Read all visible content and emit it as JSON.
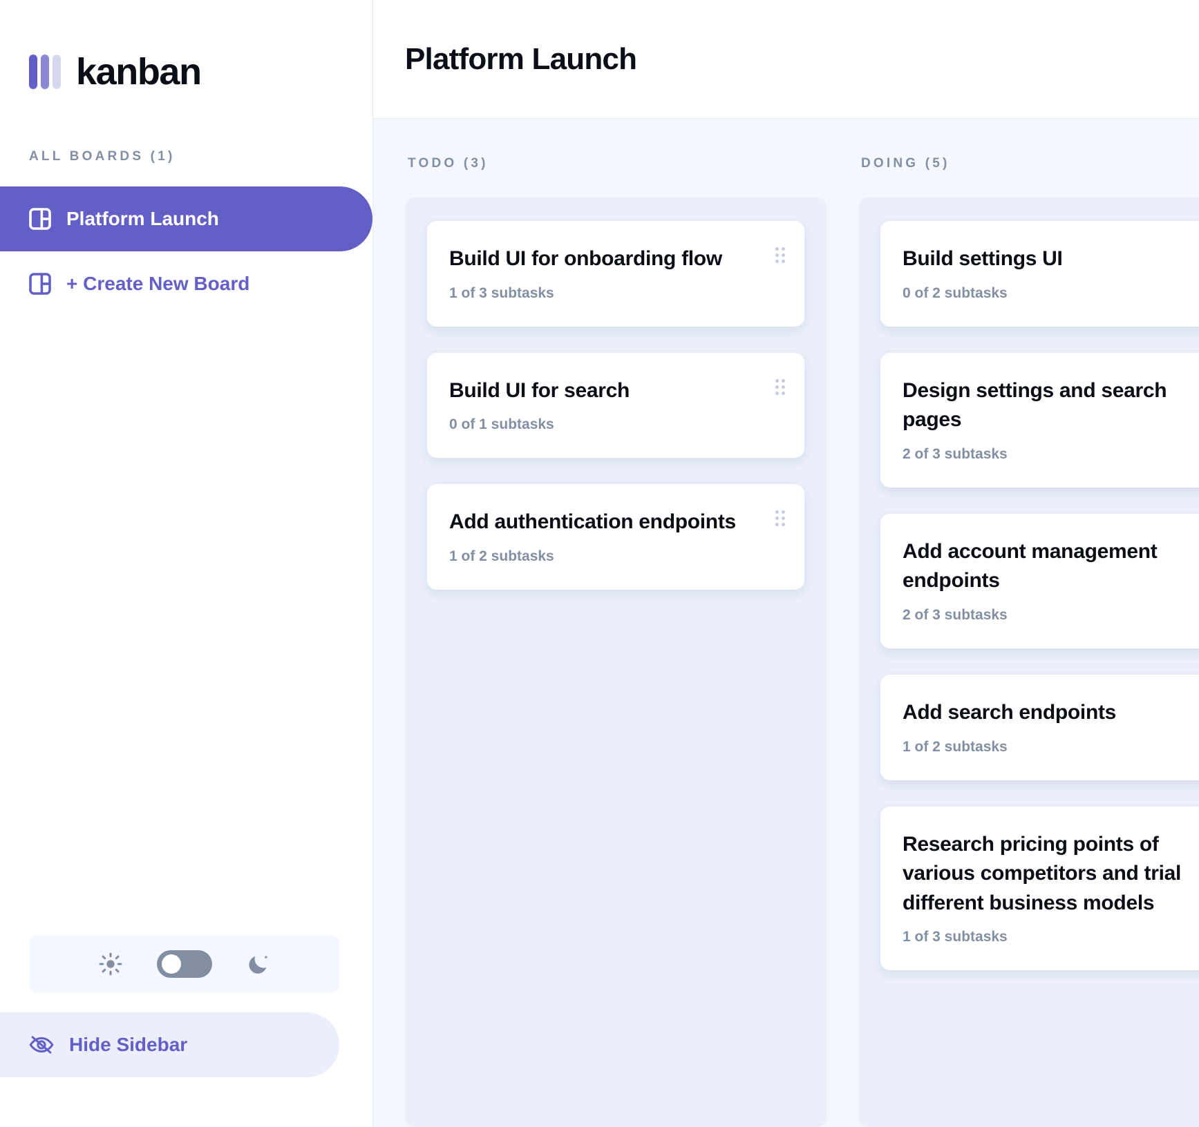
{
  "app": {
    "logo_text": "kanban"
  },
  "sidebar": {
    "boards_heading": "ALL BOARDS (1)",
    "boards": [
      {
        "label": "Platform Launch",
        "active": true
      },
      {
        "label": "+ Create New Board",
        "active": false
      }
    ],
    "theme": {
      "light_icon": "sun-icon",
      "dark_icon": "moon-icon",
      "state": "light"
    },
    "hide_sidebar_label": "Hide Sidebar"
  },
  "header": {
    "title": "Platform Launch"
  },
  "columns": [
    {
      "name": "TODO (3)",
      "cards": [
        {
          "title": "Build UI for onboarding flow",
          "subtasks": "1 of 3 subtasks"
        },
        {
          "title": "Build UI for search",
          "subtasks": "0 of 1 subtasks"
        },
        {
          "title": "Add authentication endpoints",
          "subtasks": "1 of 2 subtasks"
        }
      ]
    },
    {
      "name": "DOING (5)",
      "cards": [
        {
          "title": "Build settings UI",
          "subtasks": "0 of 2 subtasks"
        },
        {
          "title": "Design settings and search pages",
          "subtasks": "2 of 3 subtasks"
        },
        {
          "title": "Add account management endpoints",
          "subtasks": "2 of 3 subtasks"
        },
        {
          "title": "Add search endpoints",
          "subtasks": "1 of 2 subtasks"
        },
        {
          "title": "Research pricing points of various competitors and trial different business models",
          "subtasks": "1 of 3 subtasks"
        }
      ]
    }
  ],
  "colors": {
    "accent": "#635fc7",
    "board_bg": "#f4f7fd",
    "column_bg": "#eaeffa",
    "text_dark": "#0b0d17",
    "text_muted": "#828fa3"
  }
}
